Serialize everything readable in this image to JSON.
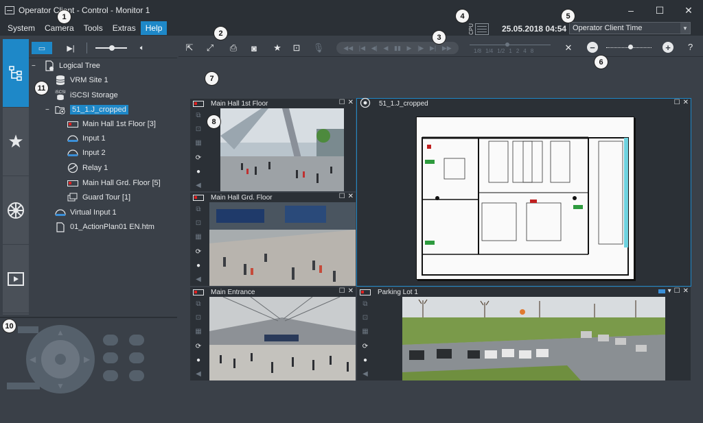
{
  "window": {
    "title": "Operator Client - Control - Monitor 1",
    "minimize": "–",
    "maximize": "☐",
    "close": "✕"
  },
  "menu": {
    "items": [
      {
        "label": "System"
      },
      {
        "label": "Camera"
      },
      {
        "label": "Tools"
      },
      {
        "label": "Extras"
      },
      {
        "label": "Help",
        "active": true
      }
    ]
  },
  "status": {
    "cpu_label": "CPU",
    "datetime": "25.05.2018 04:54",
    "time_mode": "Operator Client Time"
  },
  "callouts": [
    "1",
    "2",
    "3",
    "4",
    "5",
    "6",
    "7",
    "8",
    "10",
    "11"
  ],
  "tree": {
    "rows": [
      {
        "label": "Logical Tree",
        "icon": "logical-tree-icon"
      },
      {
        "label": "VRM Site 1",
        "icon": "vrm-database-icon"
      },
      {
        "label": "iSCSI Storage",
        "icon": "iscsi-storage-icon",
        "icon_text": "iSCSI"
      },
      {
        "label": "51_1.J_cropped",
        "icon": "map-folder-icon"
      },
      {
        "label": "Main Hall 1st Floor [3]",
        "icon": "camera-icon"
      },
      {
        "label": "Input 1",
        "icon": "input-icon"
      },
      {
        "label": "Input 2",
        "icon": "input-icon"
      },
      {
        "label": "Relay 1",
        "icon": "relay-icon"
      },
      {
        "label": "Main Hall Grd. Floor [5]",
        "icon": "camera-icon"
      },
      {
        "label": "Guard Tour [1]",
        "icon": "guard-tour-icon"
      },
      {
        "label": "Virtual Input 1",
        "icon": "virtual-input-icon"
      },
      {
        "label": "01_ActionPlan01 EN.htm",
        "icon": "document-icon"
      }
    ]
  },
  "panes": [
    {
      "title": "Main Hall 1st Floor"
    },
    {
      "title": "51_1.J_cropped"
    },
    {
      "title": "Main Hall Grd. Floor"
    },
    {
      "title": "Main Entrance"
    },
    {
      "title": "Parking Lot 1"
    }
  ],
  "playback": {
    "speed_labels": [
      "1/8",
      "1/4",
      "1/2",
      "1",
      "2",
      "4",
      "8"
    ]
  },
  "help_icon": "?",
  "colors": {
    "accent": "#1e88c8",
    "background": "#3a4048",
    "titlebar": "#2b3036"
  }
}
